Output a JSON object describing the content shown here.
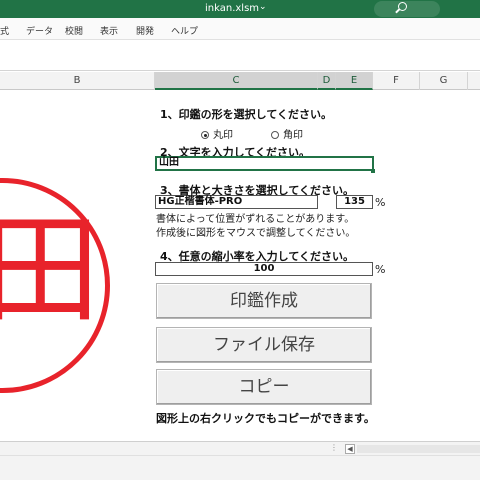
{
  "window": {
    "title": "inkan.xlsm"
  },
  "ribbon": {
    "tabs": [
      "式",
      "データ",
      "校閲",
      "表示",
      "開発",
      "ヘルプ"
    ]
  },
  "columns": [
    "B",
    "C",
    "D",
    "E",
    "F",
    "G"
  ],
  "form": {
    "step1": "1、印鑑の形を選択してください。",
    "shape_round": "丸印",
    "shape_square": "角印",
    "step2": "2、文字を入力してください。",
    "text_value": "山田",
    "step3": "3、書体と大きさを選択してください。",
    "font_value": "HG正楷書体-PRO",
    "size_value": "135",
    "percent": "%",
    "note1": "書体によって位置がずれることがあります。",
    "note2": "作成後に図形をマウスで調整してください。",
    "step4": "4、任意の縮小率を入力してください。",
    "scale_value": "100",
    "btn_create": "印鑑作成",
    "btn_save": "ファイル保存",
    "btn_copy": "コピー",
    "footer_note": "図形上の右クリックでもコピーができます。"
  },
  "stamp": {
    "char": "田",
    "color": "#e8232b"
  },
  "colors": {
    "excel_green": "#217346"
  }
}
